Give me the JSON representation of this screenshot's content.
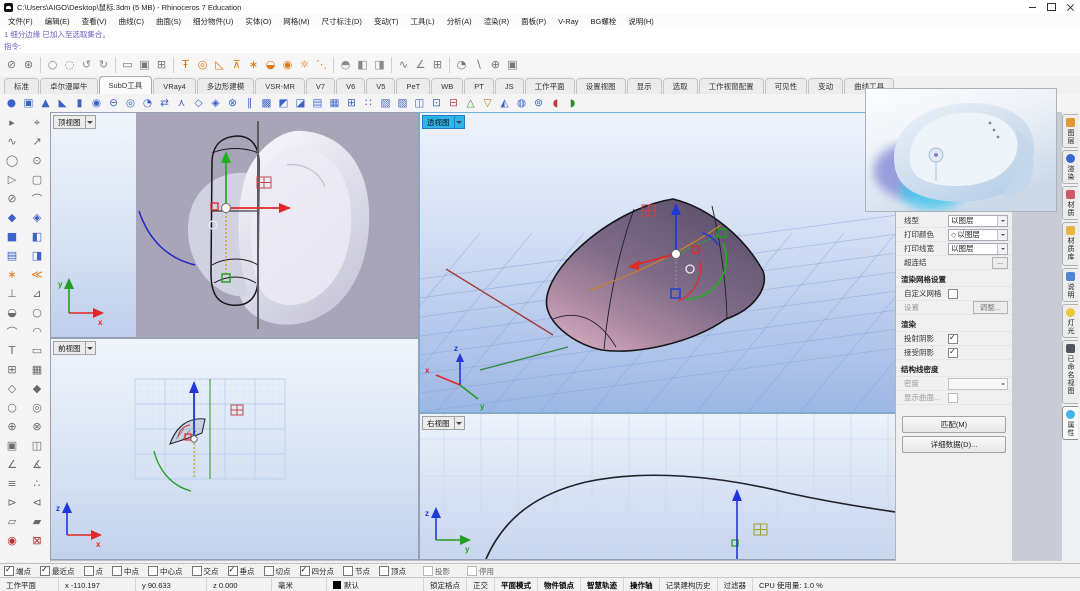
{
  "window": {
    "title": "C:\\Users\\AIGO\\Desktop\\鼠标.3dm (5 MB) - Rhinoceros 7 Education"
  },
  "menu": {
    "items": [
      "文件(F)",
      "编辑(E)",
      "查看(V)",
      "曲线(C)",
      "曲面(S)",
      "细分物件(U)",
      "实体(O)",
      "网格(M)",
      "尺寸标注(D)",
      "变动(T)",
      "工具(L)",
      "分析(A)",
      "渲染(R)",
      "面板(P)",
      "V-Ray",
      "BG螺栓",
      "说明(H)"
    ]
  },
  "command": {
    "history": "1 细分边缘 已加入至选取集合。",
    "prompt_label": "指令:"
  },
  "main_toolbar": {
    "groups": [
      [
        {
          "g": "⊘",
          "c": "#707070"
        },
        {
          "g": "⊛",
          "c": "#707070"
        }
      ],
      [
        {
          "g": "○",
          "c": "#8a8a8a"
        },
        {
          "g": "◌",
          "c": "#8a8a8a"
        },
        {
          "g": "↺",
          "c": "#8a8a8a"
        },
        {
          "g": "↻",
          "c": "#8a8a8a"
        }
      ],
      [
        {
          "g": "▭",
          "c": "#787878"
        },
        {
          "g": "▣",
          "c": "#787878"
        },
        {
          "g": "⊞",
          "c": "#787878"
        }
      ],
      [
        {
          "g": "Ŧ",
          "c": "#e07818"
        },
        {
          "g": "◎",
          "c": "#e07818"
        },
        {
          "g": "◺",
          "c": "#e07818"
        },
        {
          "g": "⊼",
          "c": "#e07818"
        },
        {
          "g": "∗",
          "c": "#e07818"
        },
        {
          "g": "◒",
          "c": "#e07818"
        },
        {
          "g": "◉",
          "c": "#e07818"
        },
        {
          "g": "☼",
          "c": "#e07818"
        },
        {
          "g": "⋱",
          "c": "#e07818"
        }
      ],
      [
        {
          "g": "◓",
          "c": "#8a8a8a"
        },
        {
          "g": "◧",
          "c": "#8a8a8a"
        },
        {
          "g": "◨",
          "c": "#8a8a8a"
        }
      ],
      [
        {
          "g": "∿",
          "c": "#787878"
        },
        {
          "g": "∠",
          "c": "#787878"
        },
        {
          "g": "⊞",
          "c": "#787878"
        }
      ],
      [
        {
          "g": "◔",
          "c": "#787878"
        },
        {
          "g": "∖",
          "c": "#787878"
        },
        {
          "g": "⊕",
          "c": "#787878"
        },
        {
          "g": "▣",
          "c": "#787878"
        }
      ]
    ]
  },
  "tabs": {
    "items": [
      "标准",
      "卓尔漫犀牛",
      "SubD工具",
      "VRay4",
      "多边形建模",
      "VSR-MR",
      "V7",
      "V6",
      "V5",
      "PeT",
      "WB",
      "PT",
      "JS",
      "工作平面",
      "设置视图",
      "显示",
      "选取",
      "工作视窗配置",
      "可见性",
      "变动",
      "曲线工具"
    ],
    "active": "SubD工具"
  },
  "subd_toolbar": {
    "icons": [
      {
        "g": "●"
      },
      {
        "g": "▣"
      },
      {
        "g": "▲"
      },
      {
        "g": "◣"
      },
      {
        "g": "▮"
      },
      {
        "g": "◉"
      },
      {
        "g": "⊖"
      },
      {
        "g": "◎"
      },
      {
        "g": "◔"
      },
      {
        "g": "⇄"
      },
      {
        "g": "⋏"
      },
      {
        "g": "◇"
      },
      {
        "g": "◈"
      },
      {
        "g": "⊗"
      },
      {
        "g": "∥"
      },
      {
        "g": "▩"
      },
      {
        "g": "◩"
      },
      {
        "g": "◪"
      },
      {
        "g": "▤"
      },
      {
        "g": "▦"
      },
      {
        "g": "⊞"
      },
      {
        "g": "∷"
      },
      {
        "g": "▧"
      },
      {
        "g": "▨"
      },
      {
        "g": "◫"
      },
      {
        "g": "⊡"
      },
      {
        "g": "⊟",
        "c": "#c04040"
      },
      {
        "g": "△",
        "c": "#309030"
      },
      {
        "g": "▽",
        "c": "#c08020"
      },
      {
        "g": "◭"
      },
      {
        "g": "◍"
      },
      {
        "g": "⊚"
      },
      {
        "g": "◖",
        "c": "#c04040"
      },
      {
        "g": "◗",
        "c": "#309030"
      }
    ]
  },
  "left_toolbar": {
    "icons": [
      {
        "g": "▸"
      },
      {
        "g": "⌖"
      },
      {
        "g": "∿"
      },
      {
        "g": "↗"
      },
      {
        "g": "◯"
      },
      {
        "g": "⊙"
      },
      {
        "g": "▷"
      },
      {
        "g": "▢"
      },
      {
        "g": "⊘"
      },
      {
        "g": "⌒"
      },
      {
        "g": "◆",
        "c": "#3a62c8"
      },
      {
        "g": "◈",
        "c": "#3a62c8"
      },
      {
        "g": "■",
        "c": "#3a62c8"
      },
      {
        "g": "◧",
        "c": "#3a62c8"
      },
      {
        "g": "▤",
        "c": "#3a62c8"
      },
      {
        "g": "◨",
        "c": "#3a62c8"
      },
      {
        "g": "∗",
        "c": "#e07818"
      },
      {
        "g": "≪",
        "c": "#e07818"
      },
      {
        "g": "⊥"
      },
      {
        "g": "⊿"
      },
      {
        "g": "◒"
      },
      {
        "g": "○"
      },
      {
        "g": "⌒"
      },
      {
        "g": "◠"
      },
      {
        "g": "T"
      },
      {
        "g": "▭"
      },
      {
        "g": "⊞"
      },
      {
        "g": "▦"
      },
      {
        "g": "◇"
      },
      {
        "g": "◆"
      },
      {
        "g": "○"
      },
      {
        "g": "◎"
      },
      {
        "g": "⊕"
      },
      {
        "g": "⊗"
      },
      {
        "g": "▣"
      },
      {
        "g": "◫"
      },
      {
        "g": "∠"
      },
      {
        "g": "∡"
      },
      {
        "g": "≡"
      },
      {
        "g": "∴"
      },
      {
        "g": "⊳"
      },
      {
        "g": "⊲"
      },
      {
        "g": "▱"
      },
      {
        "g": "▰"
      },
      {
        "g": "◉",
        "c": "#c03030"
      },
      {
        "g": "⊠",
        "c": "#c03030"
      }
    ]
  },
  "viewports": {
    "top": {
      "label": "顶视图"
    },
    "perspective": {
      "label": "透视图"
    },
    "front": {
      "label": "前视图"
    },
    "right": {
      "label": "右视图"
    }
  },
  "axis": {
    "x": "x",
    "y": "y",
    "z": "z"
  },
  "right_panel": {
    "rows": [
      {
        "type": "select",
        "label": "线型",
        "value": "以图层"
      },
      {
        "type": "select",
        "label": "打印颜色",
        "value": "以图层",
        "swatch": "◇"
      },
      {
        "type": "select",
        "label": "打印线宽",
        "value": "以图层"
      },
      {
        "type": "ellipsis",
        "label": "超连结",
        "button": "..."
      },
      {
        "type": "header",
        "label": "渲染网格设置"
      },
      {
        "type": "checkbox",
        "label": "自定义网格",
        "checked": false
      },
      {
        "type": "button-row",
        "label": "设置",
        "button": "调整...",
        "disabled": true
      },
      {
        "type": "header",
        "label": "渲染"
      },
      {
        "type": "checkbox",
        "label": "投射阴影",
        "checked": true
      },
      {
        "type": "checkbox",
        "label": "接受阴影",
        "checked": true
      },
      {
        "type": "header",
        "label": "结构线密度"
      },
      {
        "type": "spinner",
        "label": "密度",
        "disabled": true
      },
      {
        "type": "checkbox",
        "label": "显示曲面...",
        "checked": false,
        "disabled": true
      },
      {
        "type": "gap"
      },
      {
        "type": "big-button",
        "label": "匹配(M)"
      },
      {
        "type": "big-button",
        "label": "详细数据(D)..."
      }
    ]
  },
  "side_tabs": {
    "items": [
      {
        "label": "图层",
        "icon": "layers-icon",
        "color": "#e09830",
        "shape": "square"
      },
      {
        "label": "渲染",
        "icon": "render-icon",
        "color": "#3a66d0",
        "shape": "round"
      },
      {
        "label": "材质",
        "icon": "material-icon",
        "color": "#d05868",
        "shape": "square"
      },
      {
        "label": "材质库",
        "icon": "material-library-icon",
        "color": "#e8b63c",
        "shape": "square"
      },
      {
        "label": "说明",
        "icon": "help-icon",
        "color": "#5084d4",
        "shape": "square"
      },
      {
        "label": "灯光",
        "icon": "lights-icon",
        "color": "#ecc63a",
        "shape": "round"
      },
      {
        "label": "已命名视图",
        "icon": "named-views-icon",
        "color": "#50545c",
        "shape": "square"
      },
      {
        "label": "属性",
        "icon": "properties-icon",
        "color": "#3cb4e8",
        "shape": "round",
        "active": true
      }
    ]
  },
  "osnap": {
    "items": [
      {
        "label": "端点",
        "checked": true
      },
      {
        "label": "最近点",
        "checked": true
      },
      {
        "label": "点",
        "checked": false
      },
      {
        "label": "中点",
        "checked": false
      },
      {
        "label": "中心点",
        "checked": false
      },
      {
        "label": "交点",
        "checked": false
      },
      {
        "label": "垂点",
        "checked": true
      },
      {
        "label": "切点",
        "checked": false
      },
      {
        "label": "四分点",
        "checked": true
      },
      {
        "label": "节点",
        "checked": false
      },
      {
        "label": "顶点",
        "checked": false
      },
      {
        "label": "投影",
        "checked": false,
        "muted": true
      },
      {
        "label": "停用",
        "checked": false,
        "muted": true
      }
    ]
  },
  "status_bar": {
    "items": [
      {
        "label": "工作平面",
        "type": "button",
        "w": 58
      },
      {
        "label": "x -110.197",
        "w": 76
      },
      {
        "label": "y 90.633",
        "w": 70
      },
      {
        "label": "z 0.000",
        "w": 64
      },
      {
        "label": "毫米",
        "w": 54
      },
      {
        "label": "默认",
        "swatch": "#000000",
        "w": 96
      },
      {
        "label": "锁定格点",
        "type": "toggle",
        "active": false
      },
      {
        "label": "正交",
        "type": "toggle",
        "active": false
      },
      {
        "label": "平面模式",
        "type": "toggle",
        "active": true
      },
      {
        "label": "物件锁点",
        "type": "toggle",
        "active": true
      },
      {
        "label": "智慧轨迹",
        "type": "toggle",
        "active": true
      },
      {
        "label": "操作轴",
        "type": "toggle",
        "active": true
      },
      {
        "label": "记录建构历史",
        "type": "toggle",
        "active": false
      },
      {
        "label": "过滤器",
        "type": "toggle",
        "active": false
      },
      {
        "label": "CPU 使用量: 1.0 %",
        "type": "info"
      }
    ]
  }
}
